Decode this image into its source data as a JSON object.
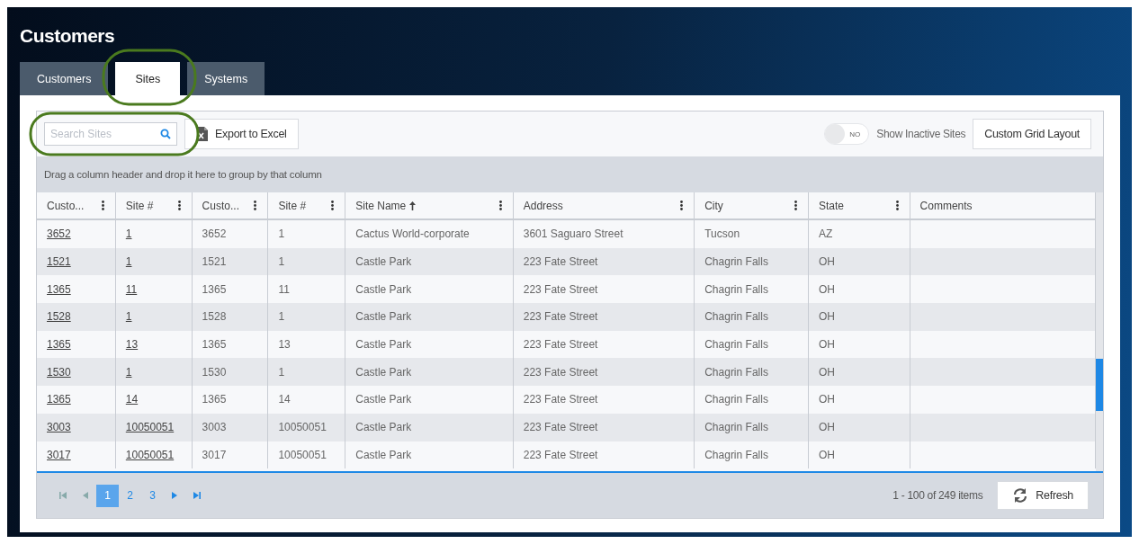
{
  "page_title": "Customers",
  "tabs": [
    {
      "label": "Customers",
      "selected": false
    },
    {
      "label": "Sites",
      "selected": true
    },
    {
      "label": "Systems",
      "selected": false
    }
  ],
  "toolbar": {
    "search": {
      "placeholder": "Search Sites"
    },
    "export_button": "Export to Excel",
    "inactive_toggle": {
      "state_text": "NO",
      "on": false,
      "label": "Show Inactive Sites"
    },
    "layout_button": "Custom Grid Layout"
  },
  "group_hint": "Drag a column header and drop it here to group by that column",
  "table": {
    "columns": [
      {
        "label": "Custo...",
        "kind": "link",
        "sorted": false
      },
      {
        "label": "Site #",
        "kind": "link",
        "sorted": false
      },
      {
        "label": "Custo...",
        "kind": "text",
        "sorted": false
      },
      {
        "label": "Site #",
        "kind": "text",
        "sorted": false
      },
      {
        "label": "Site Name",
        "kind": "text",
        "sorted": true
      },
      {
        "label": "Address",
        "kind": "text",
        "sorted": false
      },
      {
        "label": "City",
        "kind": "text",
        "sorted": false
      },
      {
        "label": "State",
        "kind": "text",
        "sorted": false
      },
      {
        "label": "Comments",
        "sorted": false
      }
    ],
    "rows": [
      [
        "3652",
        "1",
        "3652",
        "1",
        "Cactus World-corporate",
        "3601 Saguaro Street",
        "Tucson",
        "AZ",
        ""
      ],
      [
        "1521",
        "1",
        "1521",
        "1",
        "Castle Park",
        "223 Fate Street",
        "Chagrin Falls",
        "OH",
        ""
      ],
      [
        "1365",
        "11",
        "1365",
        "11",
        "Castle Park",
        "223 Fate Street",
        "Chagrin Falls",
        "OH",
        ""
      ],
      [
        "1528",
        "1",
        "1528",
        "1",
        "Castle Park",
        "223 Fate Street",
        "Chagrin Falls",
        "OH",
        ""
      ],
      [
        "1365",
        "13",
        "1365",
        "13",
        "Castle Park",
        "223 Fate Street",
        "Chagrin Falls",
        "OH",
        ""
      ],
      [
        "1530",
        "1",
        "1530",
        "1",
        "Castle Park",
        "223 Fate Street",
        "Chagrin Falls",
        "OH",
        ""
      ],
      [
        "1365",
        "14",
        "1365",
        "14",
        "Castle Park",
        "223 Fate Street",
        "Chagrin Falls",
        "OH",
        ""
      ],
      [
        "3003",
        "10050051",
        "3003",
        "10050051",
        "Castle Park",
        "223 Fate Street",
        "Chagrin Falls",
        "OH",
        ""
      ],
      [
        "3017",
        "10050051",
        "3017",
        "10050051",
        "Castle Park",
        "223 Fate Street",
        "Chagrin Falls",
        "OH",
        ""
      ]
    ]
  },
  "pager": {
    "pages": [
      {
        "label": "1",
        "selected": true
      },
      {
        "label": "2",
        "selected": false
      },
      {
        "label": "3",
        "selected": false
      }
    ],
    "summary": "1 - 100 of 249 items",
    "refresh_button": "Refresh"
  }
}
